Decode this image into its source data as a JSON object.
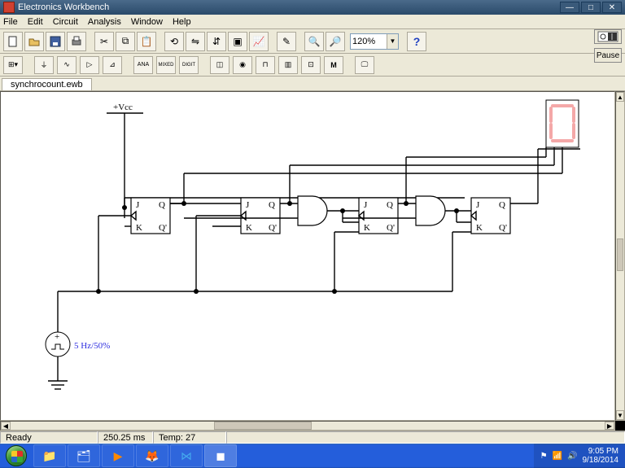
{
  "title": "Electronics Workbench",
  "menu": [
    "File",
    "Edit",
    "Circuit",
    "Analysis",
    "Window",
    "Help"
  ],
  "zoom": "120%",
  "pause_label": "Pause",
  "document_tab": "synchrocount.ewb",
  "circuit": {
    "vcc_label": "+Vcc",
    "source_label": " 5 Hz/50%",
    "jk": {
      "J": "J",
      "K": "K",
      "Q": "Q",
      "Qb": "Q'"
    }
  },
  "status": {
    "ready": "Ready",
    "time": "250.25 ms",
    "temp": "Temp:  27"
  },
  "tray": {
    "time": "9:05 PM",
    "date": "9/18/2014"
  }
}
